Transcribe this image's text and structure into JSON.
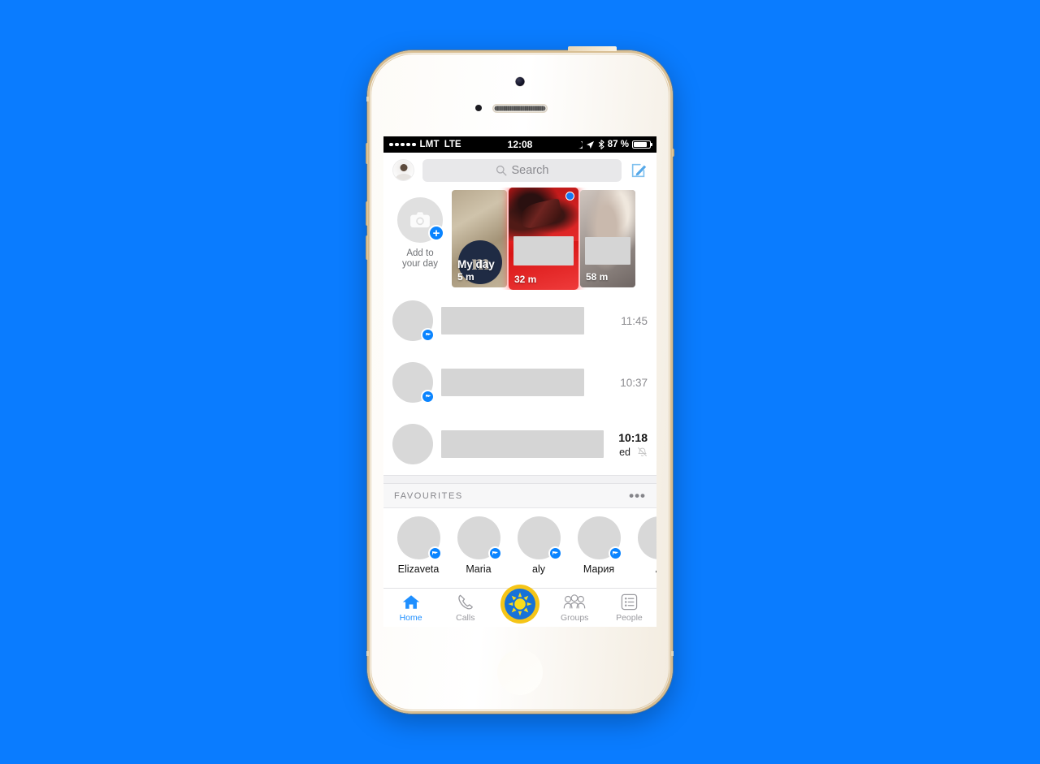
{
  "device": {
    "name": "iPhone 5s gold",
    "background_color": "#0a7cff"
  },
  "status_bar": {
    "carrier": "LMT",
    "network": "LTE",
    "time": "12:08",
    "battery_percent": "87 %",
    "signal_dots": 5,
    "icons": [
      "moon-icon",
      "location-arrow-icon",
      "bluetooth-icon",
      "battery-icon"
    ]
  },
  "header": {
    "avatar": "me-avatar",
    "search_placeholder": "Search",
    "compose": "compose-icon"
  },
  "stories": {
    "add": {
      "label_line1": "Add to",
      "label_line2": "your day",
      "plus": "+"
    },
    "items": [
      {
        "label": "My day",
        "time": "5 m",
        "unread": false,
        "style": "myday"
      },
      {
        "label": "",
        "time": "32 m",
        "unread": true,
        "style": "red"
      },
      {
        "label": "",
        "time": "58 m",
        "unread": false,
        "style": "gray"
      }
    ]
  },
  "chats": [
    {
      "time": "11:45",
      "bold": false,
      "badge": true,
      "sub": "",
      "muted": false
    },
    {
      "time": "10:37",
      "bold": false,
      "badge": true,
      "sub": "",
      "muted": false
    },
    {
      "time": "10:18",
      "bold": true,
      "badge": false,
      "sub": "ed",
      "muted": true
    }
  ],
  "favourites": {
    "title": "FAVOURITES",
    "more": "•••",
    "items": [
      {
        "name": "Elizaveta",
        "badge": true
      },
      {
        "name": "Maria",
        "badge": true
      },
      {
        "name": "aly",
        "badge": true
      },
      {
        "name": "Мария",
        "badge": true
      },
      {
        "name": "A",
        "badge": true
      }
    ]
  },
  "tab_bar": {
    "tabs": [
      {
        "label": "Home",
        "icon": "home-icon",
        "active": true
      },
      {
        "label": "Calls",
        "icon": "phone-icon",
        "active": false
      },
      {
        "label": "Groups",
        "icon": "groups-icon",
        "active": false
      },
      {
        "label": "People",
        "icon": "people-list-icon",
        "active": false
      }
    ]
  },
  "cursor": {
    "icon": "sun-cursor-icon",
    "ring_color": "#f5c518",
    "disc_color": "#1772d8"
  }
}
